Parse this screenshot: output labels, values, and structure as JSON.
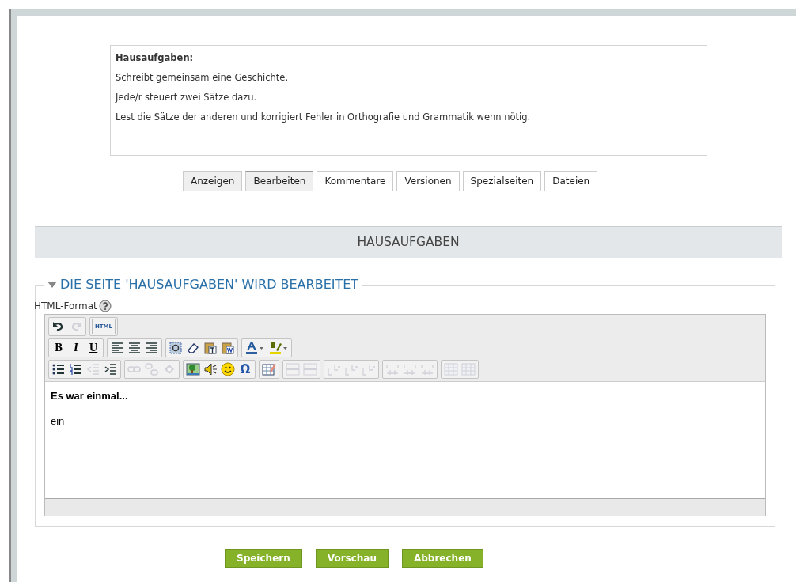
{
  "task": {
    "title": "Hausaufgaben:",
    "lines": [
      "Schreibt gemeinsam eine Geschichte.",
      "Jede/r steuert zwei Sätze dazu.",
      "Lest die Sätze der anderen und korrigiert Fehler in Orthografie und Grammatik wenn nötig."
    ]
  },
  "tabs": [
    {
      "label": "Anzeigen",
      "selected": false,
      "shaded": true
    },
    {
      "label": "Bearbeiten",
      "selected": true,
      "shaded": true
    },
    {
      "label": "Kommentare",
      "selected": false,
      "shaded": false
    },
    {
      "label": "Versionen",
      "selected": false,
      "shaded": false
    },
    {
      "label": "Spezialseiten",
      "selected": false,
      "shaded": false
    },
    {
      "label": "Dateien",
      "selected": false,
      "shaded": false
    }
  ],
  "page_heading": "HAUSAUFGABEN",
  "editor_section": {
    "legend": "DIE SEITE 'HAUSAUFGABEN' WIRD BEARBEITET",
    "expanded": true,
    "format_label": "HTML-Format",
    "toolbar": [
      [
        [
          {
            "kind": "undo",
            "disabled": false
          },
          {
            "kind": "redo",
            "disabled": true
          }
        ],
        [
          {
            "kind": "html",
            "label": "HTML",
            "disabled": false
          }
        ]
      ],
      [
        [
          {
            "kind": "bold",
            "label": "B",
            "disabled": false
          },
          {
            "kind": "italic",
            "label": "I",
            "disabled": false
          },
          {
            "kind": "underline",
            "label": "U",
            "disabled": false
          }
        ],
        [
          {
            "kind": "align-left",
            "disabled": false
          },
          {
            "kind": "align-center",
            "disabled": false
          },
          {
            "kind": "align-right",
            "disabled": false
          }
        ],
        [
          {
            "kind": "select-all",
            "disabled": false
          },
          {
            "kind": "eraser",
            "disabled": false
          },
          {
            "kind": "paste-text",
            "disabled": false
          },
          {
            "kind": "paste-word",
            "disabled": false
          }
        ],
        [
          {
            "kind": "font-color",
            "disabled": false
          },
          {
            "kind": "highlight",
            "disabled": false
          }
        ]
      ],
      [
        [
          {
            "kind": "bullets",
            "disabled": false
          },
          {
            "kind": "numbers",
            "disabled": false
          },
          {
            "kind": "outdent",
            "disabled": true
          },
          {
            "kind": "indent",
            "disabled": false
          }
        ],
        [
          {
            "kind": "link",
            "disabled": true
          },
          {
            "kind": "unlink",
            "disabled": true
          },
          {
            "kind": "anchor",
            "disabled": true
          }
        ],
        [
          {
            "kind": "image",
            "disabled": false
          },
          {
            "kind": "speaker",
            "disabled": false
          },
          {
            "kind": "smiley",
            "disabled": false
          },
          {
            "kind": "symbol",
            "label": "Ω",
            "disabled": false
          }
        ],
        [
          {
            "kind": "table",
            "disabled": false
          }
        ],
        [
          {
            "kind": "row",
            "disabled": true
          },
          {
            "kind": "row",
            "disabled": true
          }
        ],
        [
          {
            "kind": "col",
            "disabled": true
          },
          {
            "kind": "col",
            "disabled": true
          },
          {
            "kind": "col",
            "disabled": true
          }
        ],
        [
          {
            "kind": "cell",
            "disabled": true
          },
          {
            "kind": "cell",
            "disabled": true
          },
          {
            "kind": "cell",
            "disabled": true
          }
        ],
        [
          {
            "kind": "grid",
            "disabled": true
          },
          {
            "kind": "grid",
            "disabled": true
          }
        ]
      ]
    ],
    "content": [
      {
        "kind": "bold",
        "text": "Es war einmal..."
      },
      {
        "kind": "plain",
        "text": "ein"
      }
    ]
  },
  "buttons": [
    "Speichern",
    "Vorschau",
    "Abbrechen"
  ]
}
